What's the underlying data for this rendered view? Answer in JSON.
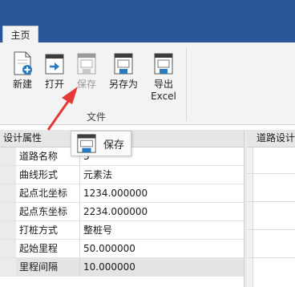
{
  "ribbon": {
    "tabs": [
      {
        "label": "主页",
        "active": true
      }
    ],
    "buttons": [
      {
        "id": "new",
        "label": "新建",
        "icon": "new-file-icon",
        "enabled": true
      },
      {
        "id": "open",
        "label": "打开",
        "icon": "open-file-icon",
        "enabled": true
      },
      {
        "id": "save",
        "label": "保存",
        "icon": "save-icon",
        "enabled": false
      },
      {
        "id": "save_as",
        "label": "另存为",
        "icon": "save-as-icon",
        "enabled": true
      },
      {
        "id": "export",
        "label_line1": "导出",
        "label_line2": "Excel",
        "icon": "export-excel-icon",
        "enabled": true
      }
    ],
    "group_label": "文件"
  },
  "tooltip": {
    "label": "保存",
    "icon": "save-icon"
  },
  "properties_panel": {
    "title": "设计属性",
    "rows": [
      {
        "name": "道路名称",
        "value": "3"
      },
      {
        "name": "曲线形式",
        "value": "元素法"
      },
      {
        "name": "起点北坐标",
        "value": "1234.000000"
      },
      {
        "name": "起点东坐标",
        "value": "2234.000000"
      },
      {
        "name": "打桩方式",
        "value": "整桩号"
      },
      {
        "name": "起始里程",
        "value": "50.000000"
      },
      {
        "name": "里程间隔",
        "value": "10.000000"
      }
    ]
  },
  "right_panel": {
    "title": "道路设计"
  },
  "colors": {
    "ribbon_bar": "#2b579a",
    "arrow": "#e53935"
  }
}
